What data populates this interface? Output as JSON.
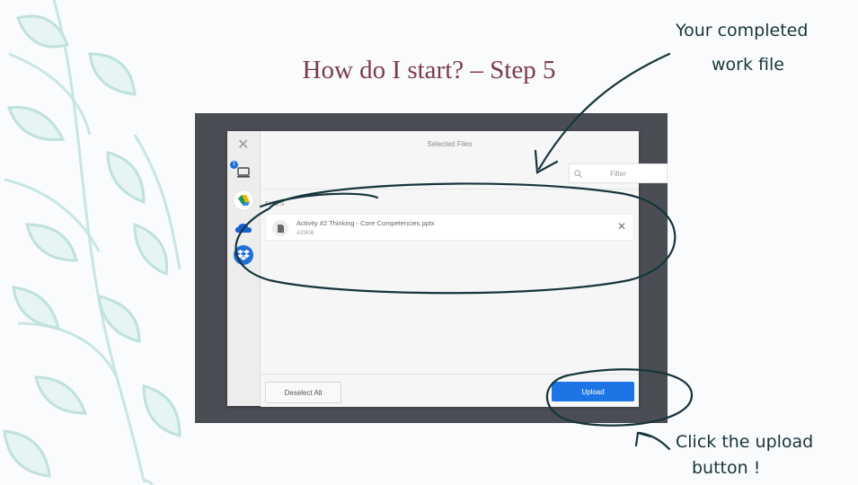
{
  "slide": {
    "title": "How do I start? – Step 5"
  },
  "dialog": {
    "close_icon": "close-icon",
    "sidebar": [
      {
        "icon": "computer-icon",
        "badge": "1"
      },
      {
        "icon": "google-drive-icon"
      },
      {
        "icon": "onedrive-icon"
      },
      {
        "icon": "dropbox-icon"
      }
    ],
    "header_title": "Selected Files",
    "filter_placeholder": "Filter",
    "files_label": "FILES",
    "files": [
      {
        "name": "Activity #2 Thinking - Core Competencies.pptx",
        "size": "429KB"
      }
    ],
    "deselect_label": "Deselect All",
    "upload_label": "Upload",
    "colors": {
      "upload": "#1d74e4",
      "frame": "#4a4e54"
    }
  },
  "annotations": {
    "top_note_line1": "Your completed",
    "top_note_line2": "work file",
    "bottom_note_line1": "Click the upload",
    "bottom_note_line2": "button !",
    "ink_color": "#17353c"
  }
}
